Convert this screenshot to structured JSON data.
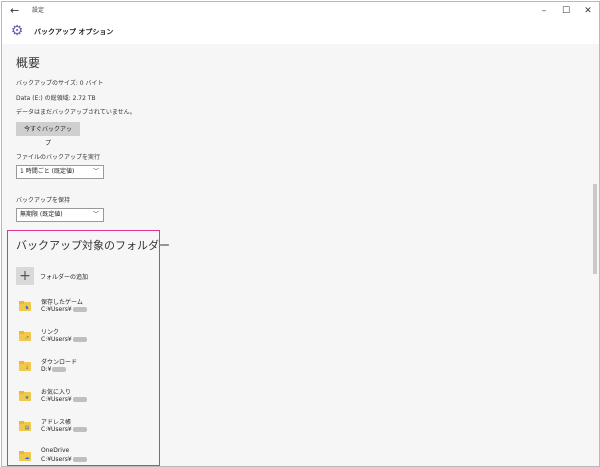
{
  "window": {
    "app_title": "設定",
    "back_glyph": "←",
    "min_glyph": "–",
    "max_glyph": "☐",
    "close_glyph": "✕"
  },
  "header": {
    "title": "バックアップ オプション",
    "gear_glyph": "⚙"
  },
  "overview": {
    "title": "概要",
    "size_line": "バックアップのサイズ: 0 バイト",
    "total_space_line": "Data (E:) の総領域: 2.72 TB",
    "status_line": "データはまだバックアップされていません。",
    "backup_now_label": "今すぐバックアップ"
  },
  "run_backup": {
    "label": "ファイルのバックアップを実行",
    "selected": "1 時間ごと (既定値)"
  },
  "keep_backup": {
    "label": "バックアップを保持",
    "selected": "無期限 (既定値)"
  },
  "folders": {
    "title": "バックアップ対象のフォルダー",
    "add_label": "フォルダーの追加",
    "add_glyph": "+",
    "items": [
      {
        "name": "保存したゲーム",
        "path": "C:¥Users¥",
        "badge": "♞"
      },
      {
        "name": "リンク",
        "path": "C:¥Users¥",
        "badge": "↗"
      },
      {
        "name": "ダウンロード",
        "path": "D:¥",
        "badge": "↓"
      },
      {
        "name": "お気に入り",
        "path": "C:¥Users¥",
        "badge": "★"
      },
      {
        "name": "アドレス帳",
        "path": "C:¥Users¥",
        "badge": "▤"
      },
      {
        "name": "OneDrive",
        "path": "C:¥Users¥",
        "badge": "☁"
      }
    ]
  },
  "colors": {
    "highlight_border": "#e2348d",
    "folder_yellow": "#f2c84b",
    "accent_purple": "#6a5bb3"
  }
}
